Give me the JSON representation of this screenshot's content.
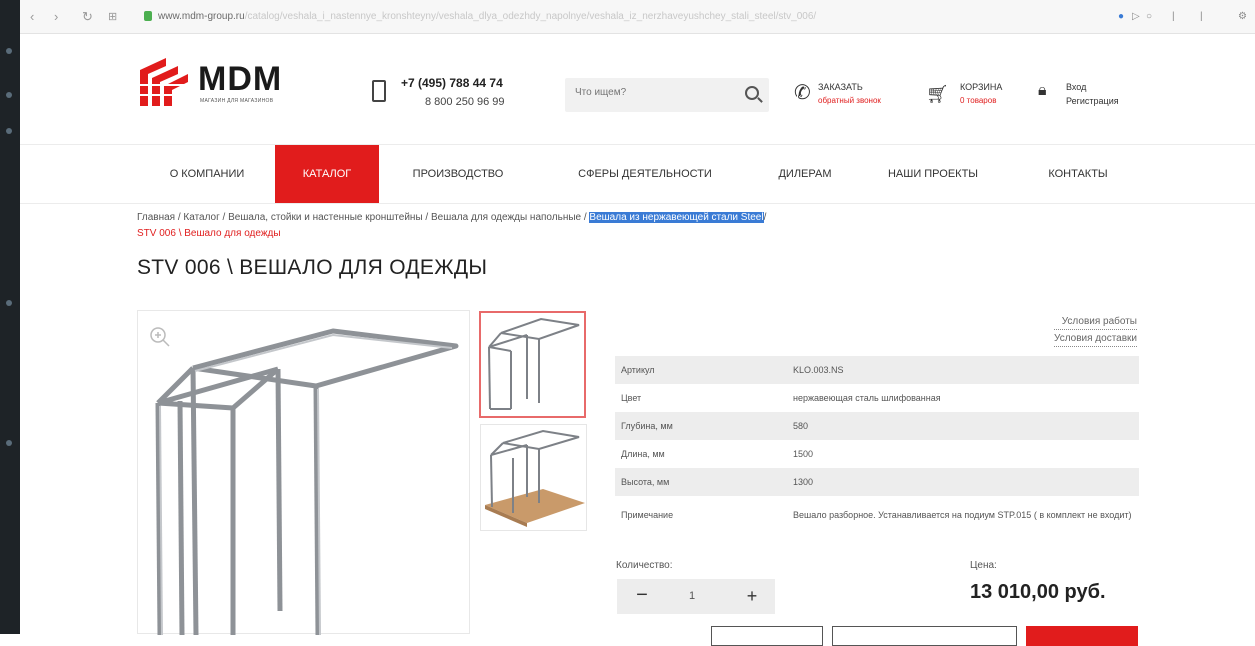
{
  "browser": {
    "url_host": "www.mdm-group.ru",
    "url_path": "/catalog/veshala_i_nastennye_kronshteyny/veshala_dlya_odezhdy_napolnye/veshala_iz_nerzhaveyushchey_stali_steel/stv_006/"
  },
  "header": {
    "logo_text": "MDM",
    "logo_tagline": "МАГАЗИН ДЛЯ МАГАЗИНОВ",
    "phone_primary": "+7 (495) 788 44 74",
    "phone_secondary": "8 800 250 96 99",
    "search_placeholder": "Что ищем?",
    "callback_title": "ЗАКАЗАТЬ",
    "callback_sub": "обратный звонок",
    "cart_title": "КОРЗИНА",
    "cart_sub": "0 товаров",
    "login_label": "Вход",
    "register_label": "Регистрация"
  },
  "menu": [
    {
      "label": "О КОМПАНИИ"
    },
    {
      "label": "КАТАЛОГ"
    },
    {
      "label": "ПРОИЗВОДСТВО"
    },
    {
      "label": "СФЕРЫ ДЕЯТЕЛЬНОСТИ"
    },
    {
      "label": "ДИЛЕРАМ"
    },
    {
      "label": "НАШИ ПРОЕКТЫ"
    },
    {
      "label": "КОНТАКТЫ"
    }
  ],
  "breadcrumbs": {
    "path": "Главная / Каталог / Вешала, стойки и настенные кронштейны / Вешала для одежды напольные / ",
    "highlighted": "Вешала из нержавеющей стали Steel",
    "separator": "/",
    "current": "STV 006 \\ Вешало для одежды"
  },
  "product": {
    "title": "STV 006 \\ ВЕШАЛО ДЛЯ ОДЕЖДЫ",
    "link_terms": "Условия работы",
    "link_delivery": "Условия доставки",
    "specs": [
      {
        "label": "Артикул",
        "value": "KLO.003.NS"
      },
      {
        "label": "Цвет",
        "value": "нержавеющая сталь шлифованная"
      },
      {
        "label": "Глубина, мм",
        "value": "580"
      },
      {
        "label": "Длина, мм",
        "value": "1500"
      },
      {
        "label": "Высота, мм",
        "value": "1300"
      },
      {
        "label": "Примечание",
        "value": "Вешало разборное. Устанавливается на подиум STP.015 ( в комплект не входит)"
      }
    ],
    "quantity_label": "Количество:",
    "quantity_value": "1",
    "minus_symbol": "−",
    "plus_symbol": "+",
    "price_label": "Цена:",
    "price_value": "13 010,00 руб."
  },
  "colors": {
    "accent": "#e11c1c",
    "highlight": "#3a7bd5"
  }
}
